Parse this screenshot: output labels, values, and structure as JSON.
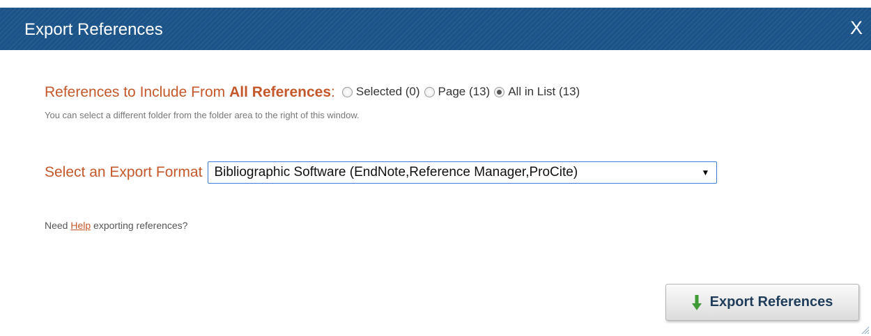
{
  "dialog": {
    "title": "Export References",
    "close_label": "X"
  },
  "include": {
    "label": "References to Include From",
    "folder": "All References",
    "colon": ":",
    "options": [
      {
        "label": "Selected (0)",
        "checked": false
      },
      {
        "label": "Page (13)",
        "checked": false
      },
      {
        "label": "All in List (13)",
        "checked": true
      }
    ],
    "note": "You can select a different folder from the folder area to the right of this window."
  },
  "format": {
    "label": "Select an Export Format",
    "selected": "Bibliographic Software (EndNote,Reference Manager,ProCite)",
    "caret": "▼"
  },
  "help": {
    "prefix": "Need ",
    "link": "Help",
    "suffix": " exporting references?"
  },
  "export_button": {
    "label": "Export References",
    "icon": "arrow-down-icon"
  },
  "colors": {
    "titlebar": "#1c5489",
    "accent": "#c4582a",
    "select_border": "#3d7bd4",
    "icon_green": "#3f9b35"
  }
}
